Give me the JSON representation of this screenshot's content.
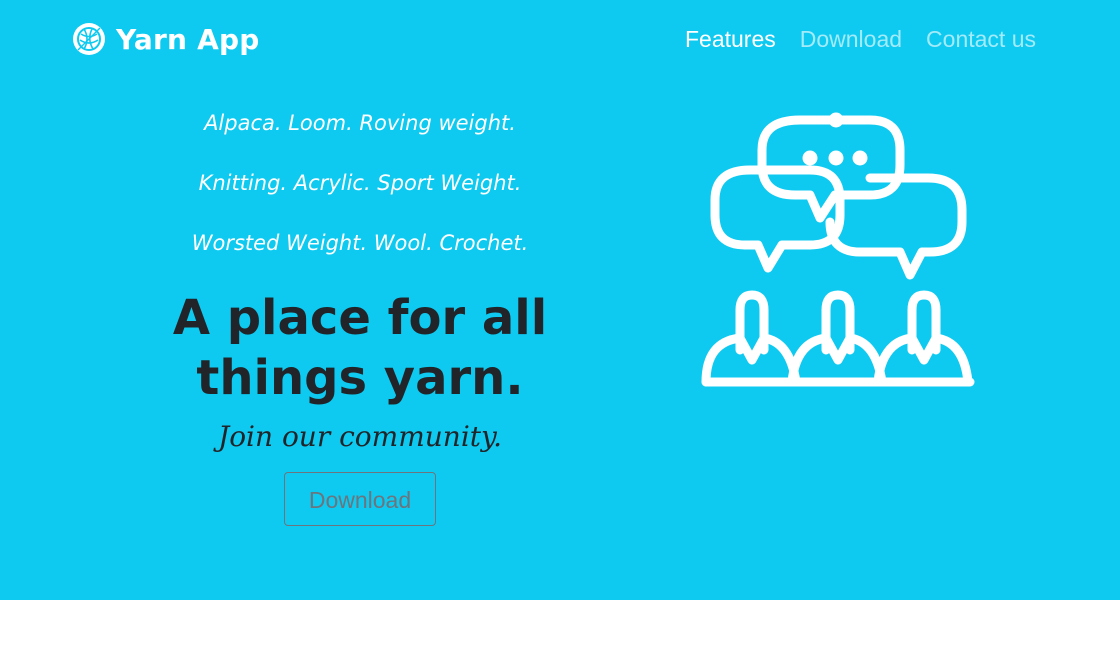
{
  "brand": {
    "name": "Yarn App",
    "logo_icon": "yarn-ball-icon"
  },
  "nav": {
    "items": [
      {
        "label": "Features",
        "active": true
      },
      {
        "label": "Download",
        "active": false
      },
      {
        "label": "Contact us",
        "active": false
      }
    ]
  },
  "hero": {
    "taglines": [
      "Alpaca. Loom. Roving weight.",
      "Knitting. Acrylic. Sport Weight.",
      "Worsted Weight. Wool. Crochet."
    ],
    "headline": "A place for all things yarn.",
    "subheading": "Join our community.",
    "download_label": "Download",
    "illustration_icon": "community-chat-icon"
  },
  "colors": {
    "hero_background": "#0ecaf0",
    "headline": "#212529",
    "button_outline": "#6c757d"
  }
}
